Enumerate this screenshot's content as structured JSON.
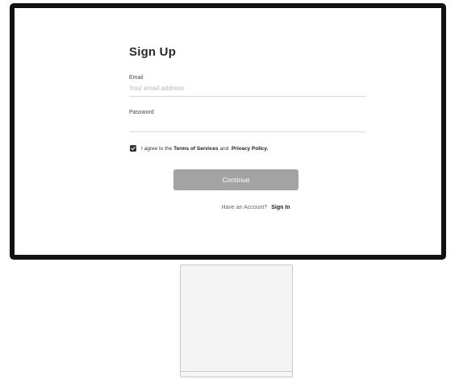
{
  "signup": {
    "title": "Sign Up",
    "email_label": "Email",
    "email_placeholder": "Your email address",
    "email_value": "",
    "password_label": "Password",
    "password_value": "",
    "agree_checked": true,
    "agree_prefix": "I agree to the",
    "terms_link": "Terms of Services",
    "agree_and": "and",
    "privacy_link": "Privacy Policy.",
    "continue_label": "Continue",
    "have_account_text": "Have an Account?",
    "signin_link": "Sign In"
  },
  "colors": {
    "frame": "#111111",
    "button_bg": "#a3a3a3",
    "checkbox_bg": "#2b3442"
  },
  "icons": {
    "checkbox": "checkmark-icon"
  }
}
